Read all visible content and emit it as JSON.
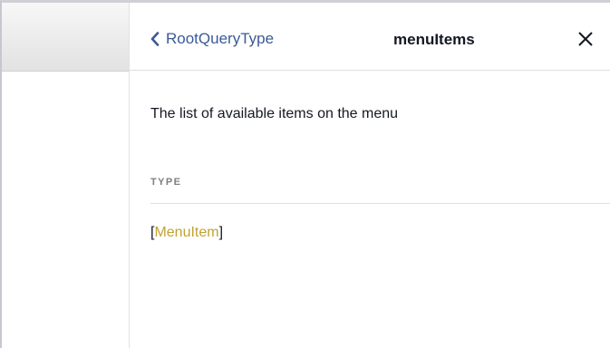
{
  "header": {
    "back_label": "RootQueryType",
    "title": "menuItems"
  },
  "description": "The list of available items on the menu",
  "type_section": {
    "label": "TYPE",
    "open_bracket": "[",
    "type_name": "MenuItem",
    "close_bracket": "]"
  },
  "icons": {
    "back": "chevron-left-icon",
    "close": "close-icon"
  },
  "colors": {
    "link": "#3b5998",
    "type_name": "#c0a331",
    "text": "#141823",
    "section_label": "#7f7f7f"
  }
}
